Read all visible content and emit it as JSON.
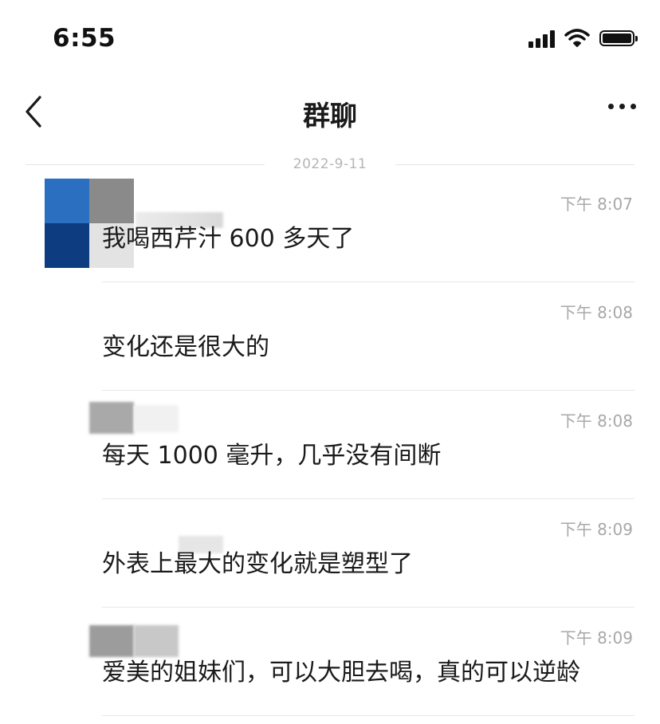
{
  "status_bar": {
    "time": "6:55"
  },
  "nav": {
    "title": "群聊"
  },
  "date_label": "2022-9-11",
  "messages": [
    {
      "time": "下午 8:07",
      "text": "我喝西芹汁 600 多天了"
    },
    {
      "time": "下午 8:08",
      "text": "变化还是很大的"
    },
    {
      "time": "下午 8:08",
      "text": "每天 1000 毫升，几乎没有间断"
    },
    {
      "time": "下午 8:09",
      "text": "外表上最大的变化就是塑型了"
    },
    {
      "time": "下午 8:09",
      "text": "爱美的姐妹们，可以大胆去喝，真的可以逆龄"
    }
  ]
}
